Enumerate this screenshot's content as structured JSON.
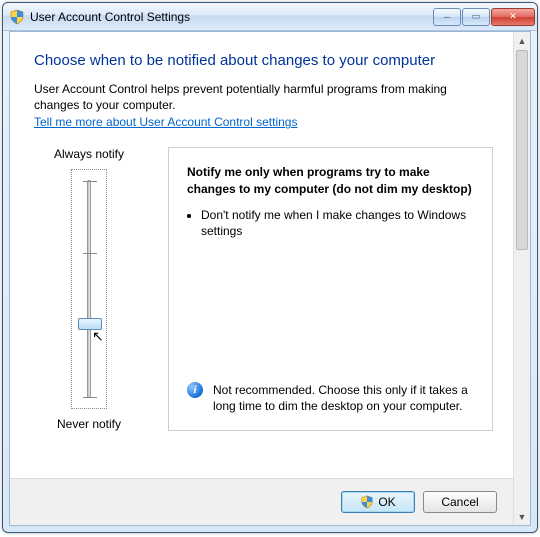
{
  "window": {
    "title": "User Account Control Settings"
  },
  "heading": "Choose when to be notified about changes to your computer",
  "intro": "User Account Control helps prevent potentially harmful programs from making changes to your computer.",
  "link_text": "Tell me more about User Account Control settings",
  "slider": {
    "top_label": "Always notify",
    "bottom_label": "Never notify",
    "levels": 4,
    "current_level": 1
  },
  "description": {
    "title": "Notify me only when programs try to make changes to my computer (do not dim my desktop)",
    "bullets": [
      "Don't notify me when I make changes to Windows settings"
    ],
    "recommendation": "Not recommended. Choose this only if it takes a long time to dim the desktop on your computer."
  },
  "buttons": {
    "ok": "OK",
    "cancel": "Cancel"
  }
}
